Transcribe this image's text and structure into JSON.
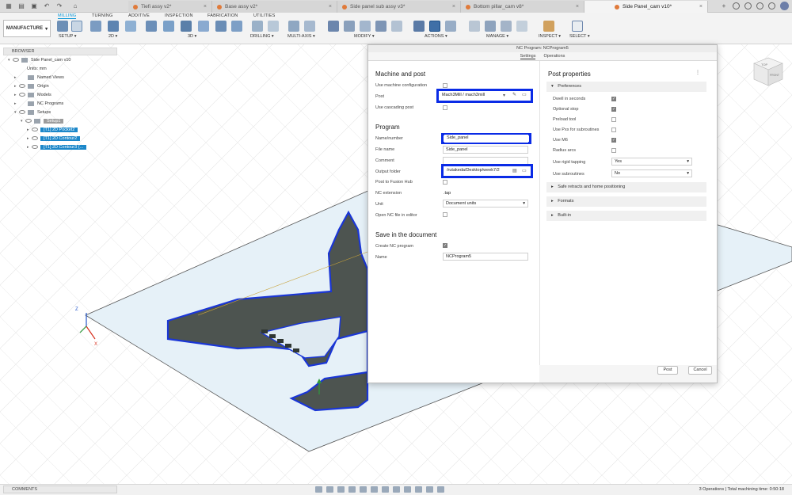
{
  "doc_tabs": [
    {
      "label": "Tiefi assy v2*"
    },
    {
      "label": "Base assy v2*"
    },
    {
      "label": "Side panel sub assy v3*"
    },
    {
      "label": "Bottom pillar_cam v8*"
    },
    {
      "label": "Side Panel_cam v10*"
    }
  ],
  "ribbon": {
    "workspace": "MANUFACTURE",
    "tabs": [
      "MILLING",
      "TURNING",
      "ADDITIVE",
      "INSPECTION",
      "FABRICATION",
      "UTILITIES"
    ],
    "groups": [
      "SETUP",
      "2D",
      "3D",
      "DRILLING",
      "MULTI-AXIS",
      "MODIFY",
      "ACTIONS",
      "MANAGE",
      "INSPECT",
      "SELECT"
    ]
  },
  "browser": {
    "title": "BROWSER",
    "root": "Side Panel_cam v10",
    "units": "Units: mm",
    "named_views": "Named Views",
    "origin": "Origin",
    "models": "Models",
    "nc_programs": "NC Programs",
    "setups": "Setups",
    "setup1": "Setup1",
    "ops": [
      "[T1] 2D Pocket2",
      "[T1] 2D Contour2",
      "[T1] 2D Contour3 (..."
    ]
  },
  "dialog": {
    "title": "NC Program: NCProgram5",
    "tabs": [
      "Settings",
      "Operations"
    ],
    "machine_post": {
      "heading": "Machine and post",
      "use_machine_config": "Use machine configuration",
      "post_label": "Post",
      "post_value": "Mach3Mill / mach3mill",
      "use_cascading_post": "Use cascading post"
    },
    "program": {
      "heading": "Program",
      "name_label": "Name/number",
      "name_value": "Side_panel",
      "file_label": "File name",
      "file_value": "Side_panel",
      "comment_label": "Comment",
      "output_label": "Output folder",
      "output_value": "/rutakeda/Desktop/week7/2",
      "post_hub_label": "Post to Fusion Hub",
      "ext_label": "NC extension",
      "ext_value": ".tap",
      "unit_label": "Unit",
      "unit_value": "Document units",
      "open_label": "Open NC file in editor"
    },
    "save": {
      "heading": "Save in the document",
      "create_label": "Create NC program",
      "name_label": "Name",
      "name_value": "NCProgram5"
    },
    "post_properties": {
      "heading": "Post properties",
      "preferences": "Preferences",
      "items": [
        {
          "label": "Dwell in seconds",
          "checked": true
        },
        {
          "label": "Optional stop",
          "checked": true
        },
        {
          "label": "Preload tool",
          "checked": false
        },
        {
          "label": "Use Pxx for subroutines",
          "checked": false
        },
        {
          "label": "Use M6",
          "checked": true
        },
        {
          "label": "Radius arcs",
          "checked": false
        }
      ],
      "rigid_label": "Use rigid tapping",
      "rigid_value": "Yes",
      "subroutines_label": "Use subroutines",
      "subroutines_value": "No",
      "sections": [
        "Safe retracts and home positioning",
        "Formats",
        "Built-in"
      ]
    },
    "post_button": "Post",
    "cancel_button": "Cancel"
  },
  "bottom": {
    "comments": "COMMENTS",
    "status": "3 Operations | Total machining time: 0:50:18"
  },
  "viewcube": {
    "top": "TOP",
    "front": "FRONT"
  },
  "axes": {
    "z": "Z",
    "x": "X"
  },
  "colors": {
    "selection_blue": "#1c87c9",
    "highlight_box": "#0a2be6",
    "accent": "#0696d7"
  }
}
